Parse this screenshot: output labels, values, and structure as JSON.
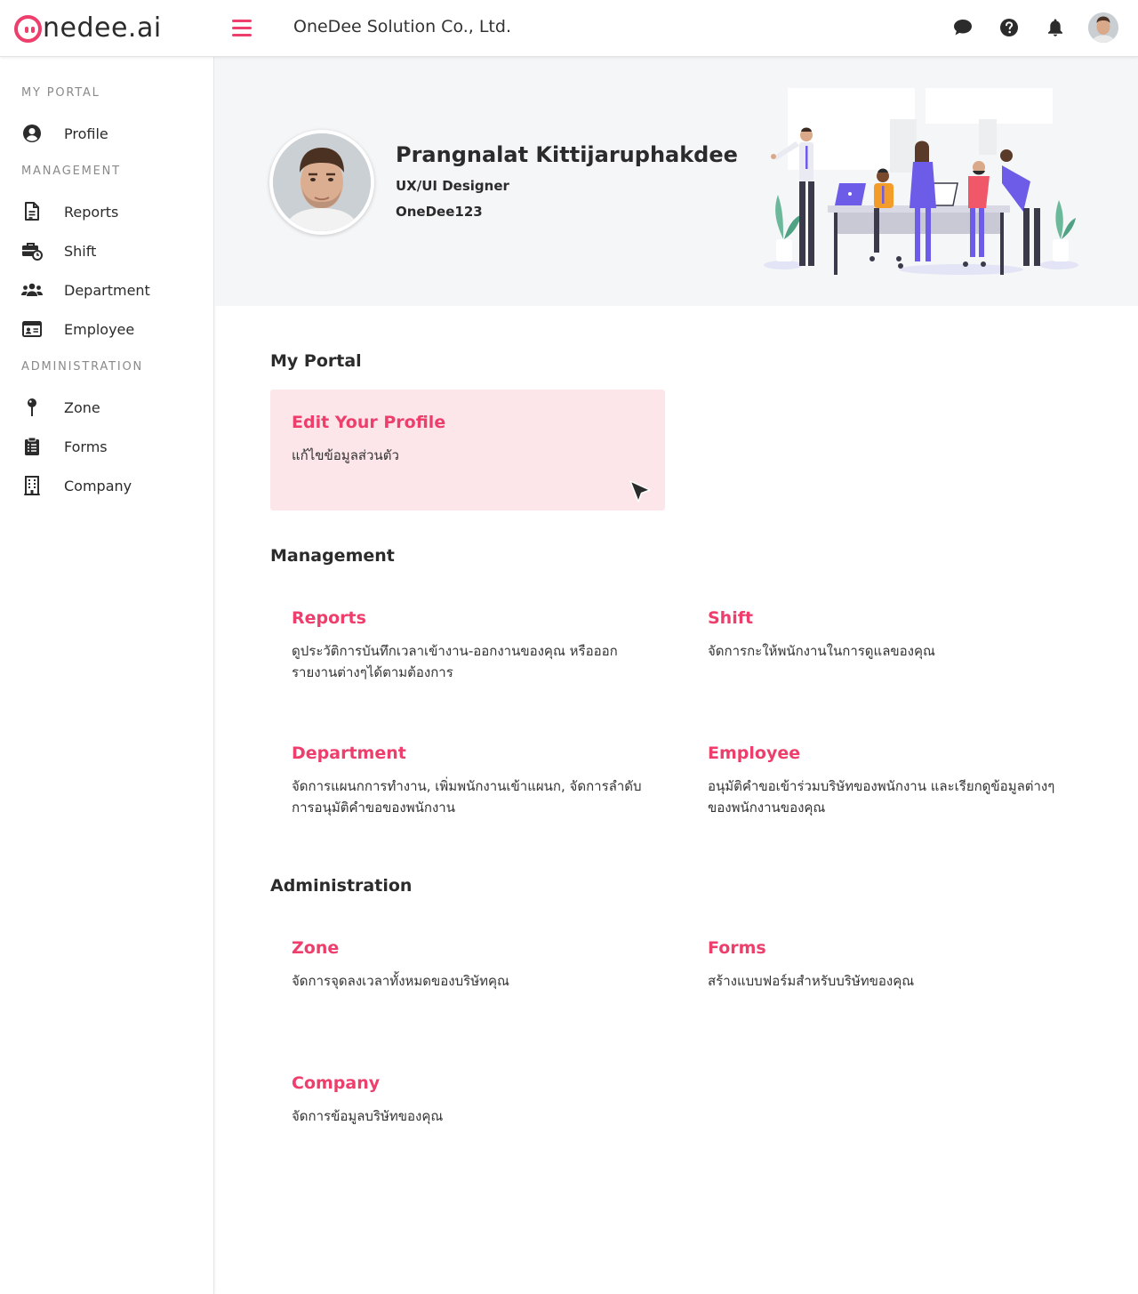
{
  "brand": {
    "logo_text": "nedee.ai",
    "accent": "#ed3e6c"
  },
  "header": {
    "company": "OneDee Solution Co., Ltd.",
    "icons": [
      "chat-icon",
      "help-icon",
      "bell-icon",
      "user-avatar"
    ]
  },
  "sidebar": {
    "sections": [
      {
        "title": "MY PORTAL",
        "items": [
          {
            "label": "Profile",
            "icon": "user-circle-icon"
          }
        ]
      },
      {
        "title": "MANAGEMENT",
        "items": [
          {
            "label": "Reports",
            "icon": "document-icon"
          },
          {
            "label": "Shift",
            "icon": "briefcase-clock-icon"
          },
          {
            "label": "Department",
            "icon": "users-icon"
          },
          {
            "label": "Employee",
            "icon": "id-card-icon"
          }
        ]
      },
      {
        "title": "ADMINISTRATION",
        "items": [
          {
            "label": "Zone",
            "icon": "pin-icon"
          },
          {
            "label": "Forms",
            "icon": "clipboard-icon"
          },
          {
            "label": "Company",
            "icon": "building-icon"
          }
        ]
      }
    ]
  },
  "profile": {
    "name": "Prangnalat Kittijaruphakdee",
    "role": "UX/UI Designer",
    "username": "OneDee123"
  },
  "main": {
    "my_portal": {
      "title": "My Portal",
      "cards": [
        {
          "title": "Edit Your Profile",
          "desc": "แก้ไขข้อมูลส่วนตัว"
        }
      ]
    },
    "management": {
      "title": "Management",
      "cards": [
        {
          "title": "Reports",
          "desc": "ดูประวัติการบันทึกเวลาเข้างาน-ออกงานของคุณ หรือออกรายงานต่างๆได้ตามต้องการ"
        },
        {
          "title": "Shift",
          "desc": "จัดการกะให้พนักงานในการดูแลของคุณ"
        },
        {
          "title": "Department",
          "desc": "จัดการแผนกการทำงาน, เพิ่มพนักงานเข้าแผนก, จัดการลำดับการอนุมัติคำขอของพนักงาน"
        },
        {
          "title": "Employee",
          "desc": "อนุมัติคำขอเข้าร่วมบริษัทของพนักงาน และเรียกดูข้อมูลต่างๆ ของพนักงานของคุณ"
        }
      ]
    },
    "administration": {
      "title": "Administration",
      "cards": [
        {
          "title": "Zone",
          "desc": "จัดการจุดลงเวลาทั้งหมดของบริษัทคุณ"
        },
        {
          "title": "Forms",
          "desc": "สร้างแบบฟอร์มสำหรับบริษัทของคุณ"
        },
        {
          "title": "Company",
          "desc": "จัดการข้อมูลบริษัทของคุณ"
        }
      ]
    }
  }
}
